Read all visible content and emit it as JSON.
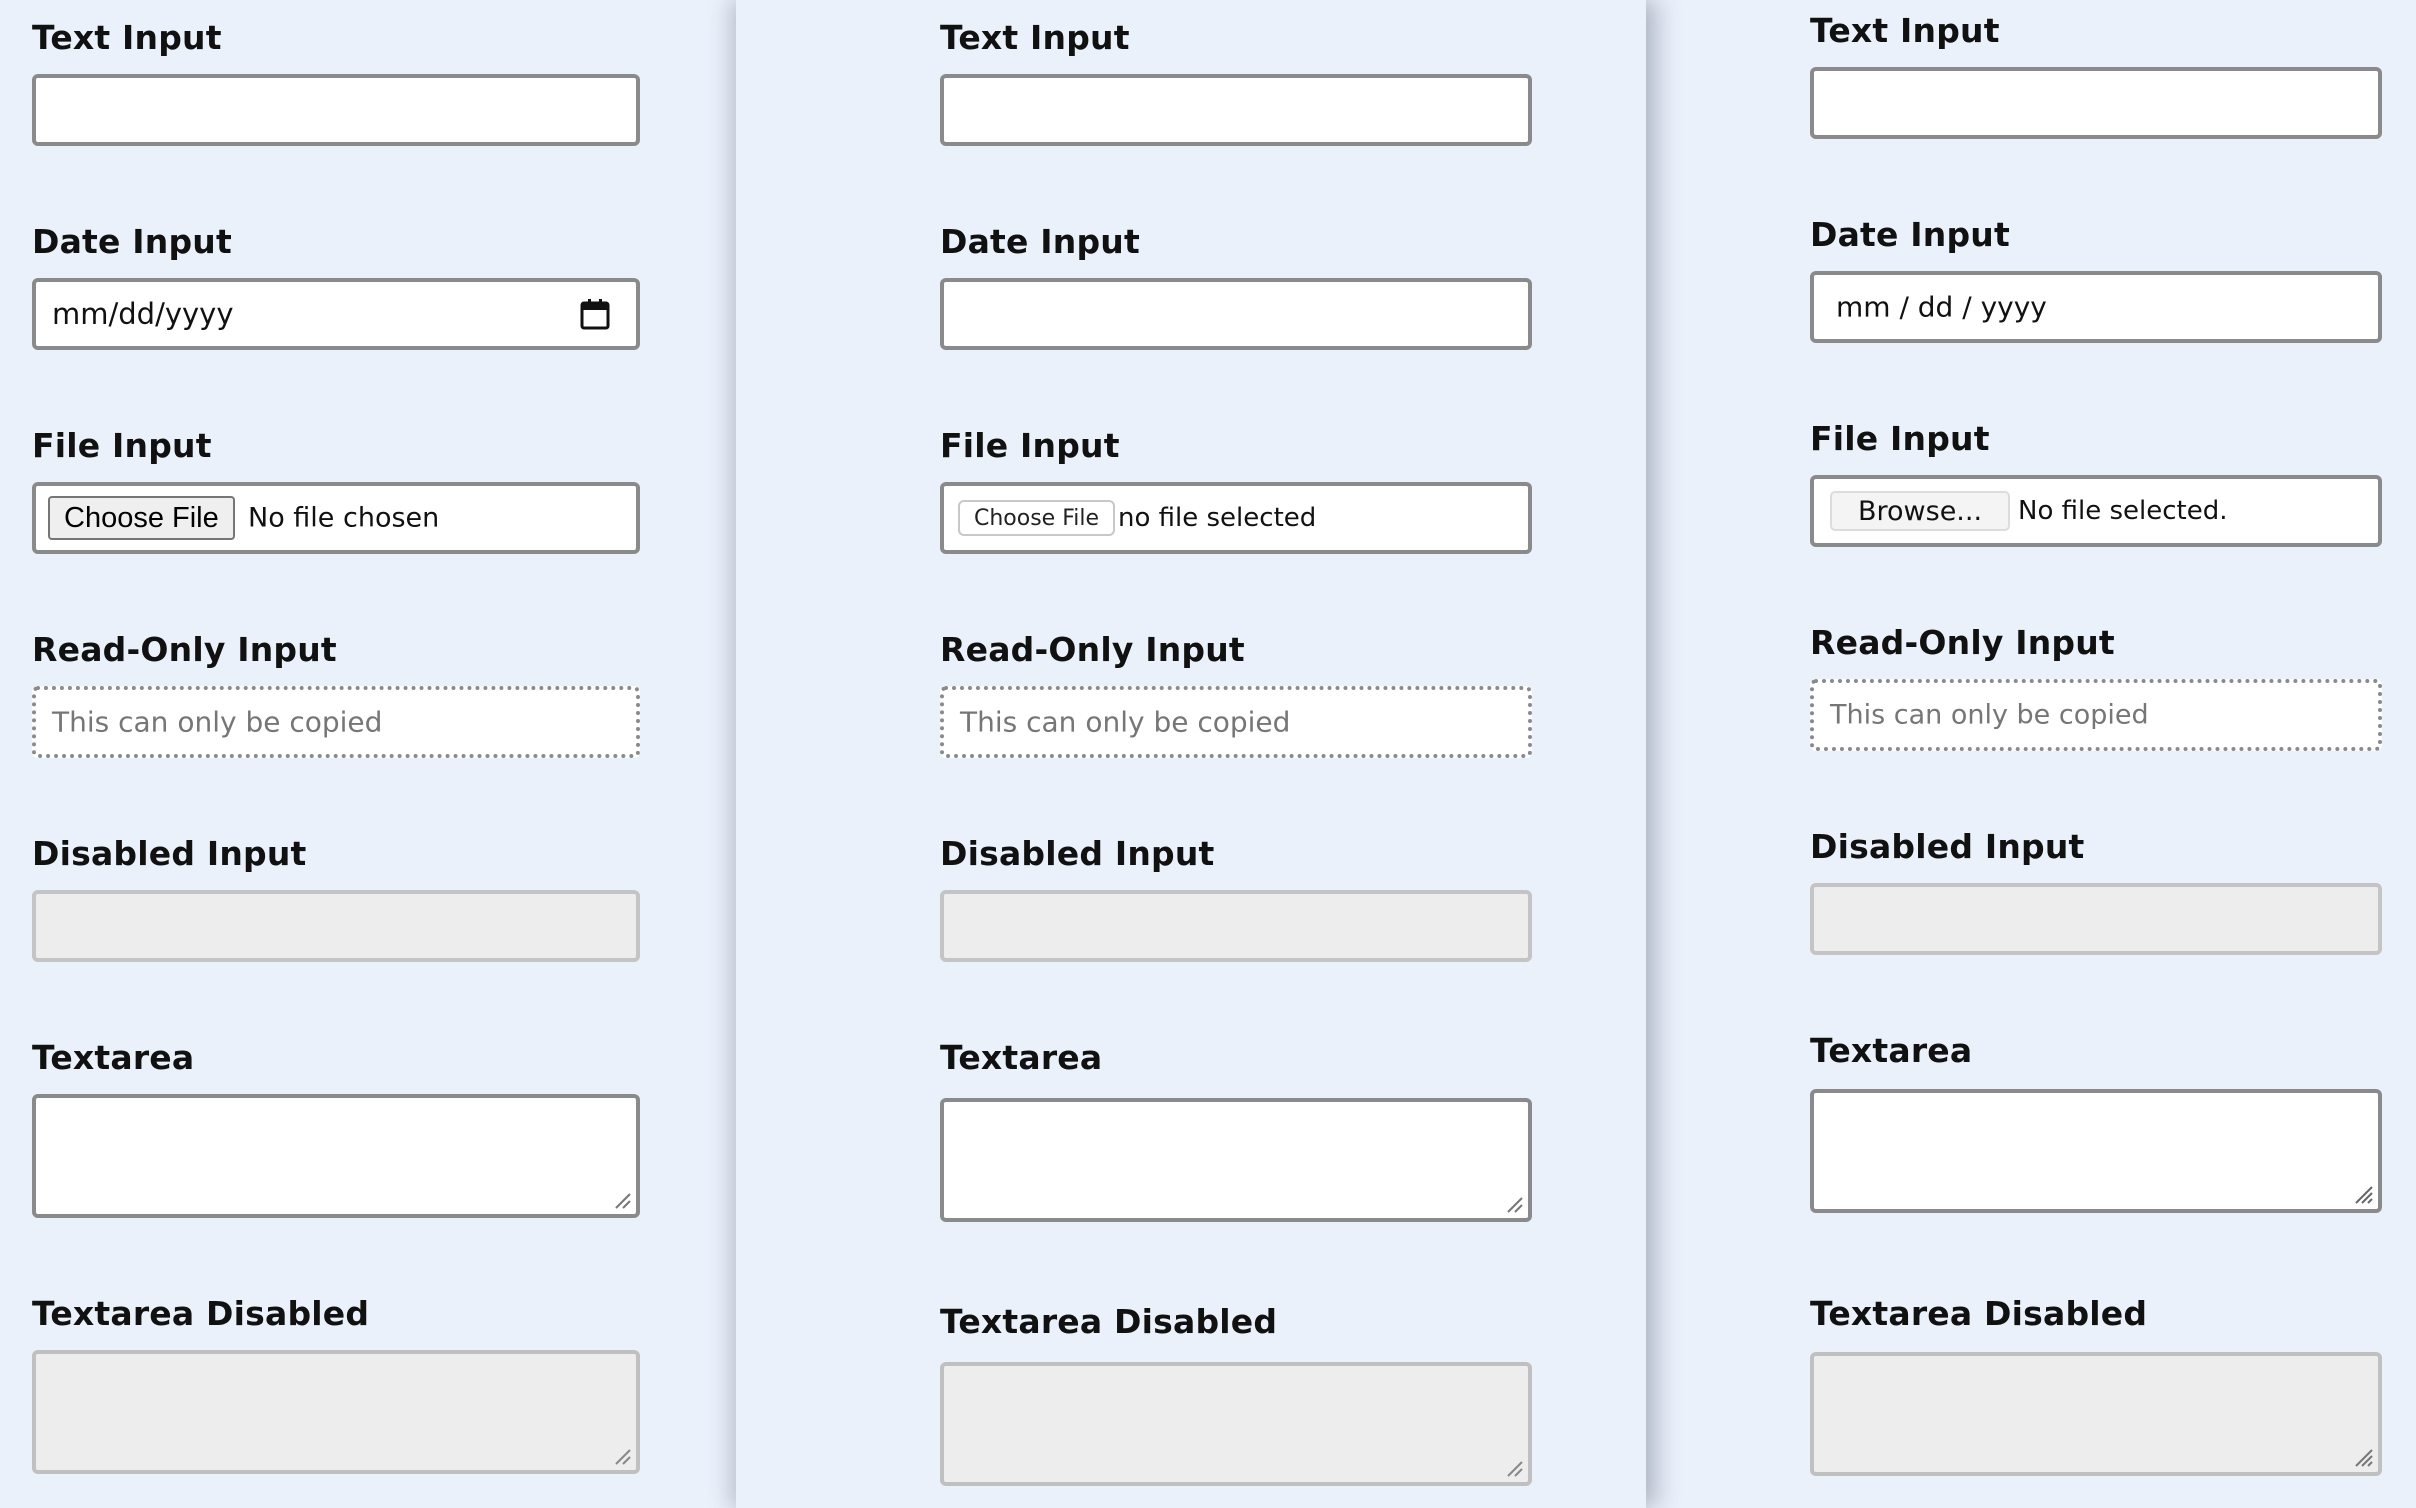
{
  "panels": [
    {
      "id": "chrome",
      "text_input": {
        "label": "Text Input",
        "value": ""
      },
      "date_input": {
        "label": "Date Input",
        "value": "mm/dd/yyyy",
        "icon": "calendar-icon"
      },
      "file_input": {
        "label": "File Input",
        "button_label": "Choose File",
        "status": "No file chosen"
      },
      "readonly_input": {
        "label": "Read-Only Input",
        "value": "This can only be copied"
      },
      "disabled_input": {
        "label": "Disabled Input",
        "value": ""
      },
      "textarea": {
        "label": "Textarea",
        "value": ""
      },
      "textarea_disabled": {
        "label": "Textarea Disabled",
        "value": ""
      }
    },
    {
      "id": "safari",
      "text_input": {
        "label": "Text Input",
        "value": ""
      },
      "date_input": {
        "label": "Date Input",
        "value": ""
      },
      "file_input": {
        "label": "File Input",
        "button_label": "Choose File",
        "status": "no file selected"
      },
      "readonly_input": {
        "label": "Read-Only Input",
        "value": "This can only be copied"
      },
      "disabled_input": {
        "label": "Disabled Input",
        "value": ""
      },
      "textarea": {
        "label": "Textarea",
        "value": ""
      },
      "textarea_disabled": {
        "label": "Textarea Disabled",
        "value": ""
      }
    },
    {
      "id": "firefox",
      "text_input": {
        "label": "Text Input",
        "value": ""
      },
      "date_input": {
        "label": "Date Input",
        "value": "mm / dd / yyyy"
      },
      "file_input": {
        "label": "File Input",
        "button_label": "Browse...",
        "status": "No file selected."
      },
      "readonly_input": {
        "label": "Read-Only Input",
        "value": "This can only be copied"
      },
      "disabled_input": {
        "label": "Disabled Input",
        "value": ""
      },
      "textarea": {
        "label": "Textarea",
        "value": ""
      },
      "textarea_disabled": {
        "label": "Textarea Disabled",
        "value": ""
      }
    }
  ],
  "colors": {
    "background": "#eaf1fb",
    "border": "#8a8a8a",
    "disabled_fill": "#ededed",
    "placeholder": "#767676"
  }
}
